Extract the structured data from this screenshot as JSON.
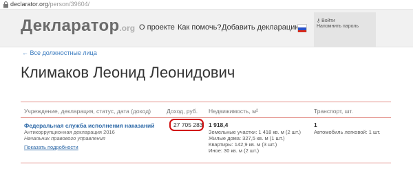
{
  "browser": {
    "url_host": "declarator.org",
    "url_path": "/person/39604/"
  },
  "header": {
    "logo_main": "Декларатор",
    "logo_tld": ".org",
    "nav": [
      "О проекте",
      "Как помочь?",
      "Добавить декларацию"
    ],
    "login_label": "Войти",
    "remind_label": "Напомнить пароль"
  },
  "page": {
    "back_link": "← Все должностные лица",
    "person_name": "Климаков Леонид Леонидович"
  },
  "table": {
    "headers": {
      "institution": "Учреждение, декларация, статус, дата (доход)",
      "income": "Доход, руб.",
      "property": "Недвижимость, м²",
      "transport": "Транспорт, шт."
    },
    "row": {
      "organization": "Федеральная служба исполнения наказаний",
      "declaration": "Антикоррупционная декларация 2016",
      "position": "Начальник правового управления",
      "details_link": "Показать подробности",
      "income": "27 705 283",
      "property_total": "1 918,4",
      "property_items": [
        "Земельные участки: 1 418 кв. м (2 шт.)",
        "Жилые дома: 327,5 кв. м (1 шт.)",
        "Квартиры: 142,9 кв. м (3 шт.)",
        "Иное: 30 кв. м (2 шт.)"
      ],
      "transport_total": "1",
      "transport_items": [
        "Автомобиль легковой: 1 шт."
      ]
    }
  },
  "colors": {
    "link": "#2f6aa8",
    "divider": "#e28d86",
    "highlight": "#d10c0c",
    "header_bg": "#f1f1f1"
  }
}
